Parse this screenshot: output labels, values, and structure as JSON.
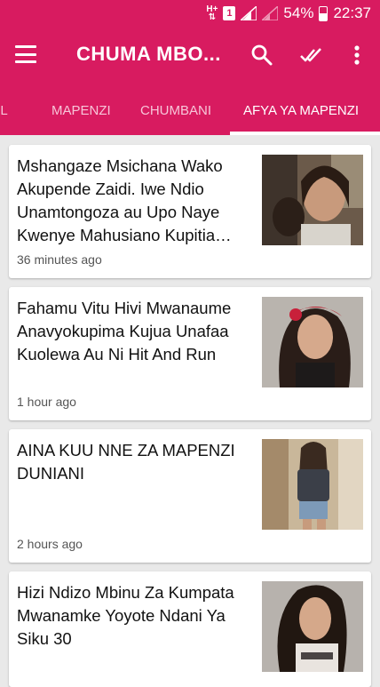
{
  "status_bar": {
    "network": "H+",
    "sim": "1",
    "battery_percent": "54%",
    "time": "22:37"
  },
  "toolbar": {
    "title": "CHUMA MBO...",
    "icons": [
      "menu-icon",
      "search-icon",
      "mark-read-icon",
      "more-vert-icon"
    ]
  },
  "tabs": [
    {
      "label": "LL",
      "active": false
    },
    {
      "label": "MAPENZI",
      "active": false
    },
    {
      "label": "CHUMBANI",
      "active": false
    },
    {
      "label": "AFYA YA MAPENZI",
      "active": true
    }
  ],
  "articles": [
    {
      "title": "Mshangaze Msichana Wako Akupende Zaidi. Iwe Ndio Unamtongoza au Upo Naye Kwenye Mahusiano Kupitia Hizi Mbinu",
      "time": "36 minutes ago"
    },
    {
      "title": "Fahamu Vitu Hivi Mwanaume Anavyokupima Kujua Unafaa Kuolewa Au Ni Hit And Run",
      "time": "1 hour ago"
    },
    {
      "title": "AINA KUU NNE ZA MAPENZI DUNIANI",
      "time": "2 hours ago"
    },
    {
      "title": "Hizi Ndizo Mbinu Za Kumpata Mwanamke Yoyote Ndani Ya Siku 30",
      "time": ""
    }
  ],
  "colors": {
    "primary": "#d81b60",
    "background": "#e9e9e9"
  }
}
